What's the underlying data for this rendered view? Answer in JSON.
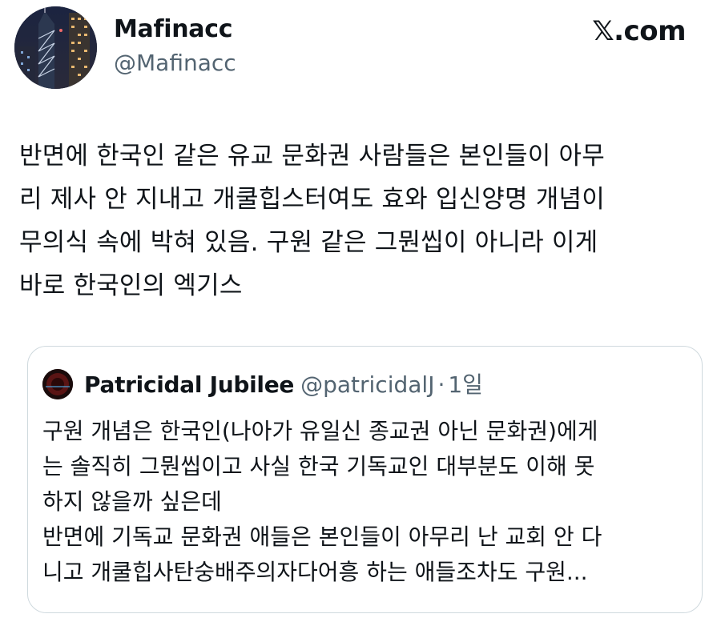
{
  "post": {
    "author": {
      "name": "Mafinacc",
      "handle": "@Mafinacc",
      "avatar": "city-night-skyline-avatar"
    },
    "site_mark": "𝕏.com",
    "text_lines": [
      "반면에 한국인 같은 유교 문화권 사람들은 본인들이 아무",
      "리 제사 안 지내고 개쿨힙스터여도 효와 입신양명 개념이",
      "무의식 속에 박혀 있음. 구원 같은 그뭔씹이 아니라 이게",
      "바로 한국인의 엑기스"
    ]
  },
  "quote": {
    "author": {
      "name": "Patricidal Jubilee",
      "handle": "@patricidalJ",
      "separator": "·",
      "time": "1일",
      "avatar": "dark-red-abstract-avatar"
    },
    "text_lines": [
      "구원 개념은 한국인(나아가 유일신 종교권 아닌 문화권)에게",
      "는 솔직히 그뭔씹이고 사실 한국 기독교인 대부분도 이해 못",
      "하지 않을까 싶은데",
      "반면에 기독교 문화권 애들은 본인들이 아무리 난 교회 안 다",
      "니고 개쿨힙사탄숭배주의자다어흥 하는 애들조차도 구원..."
    ]
  },
  "colors": {
    "text_primary": "#0f1419",
    "text_secondary": "#536471",
    "border": "#cfd9de",
    "background": "#ffffff"
  }
}
